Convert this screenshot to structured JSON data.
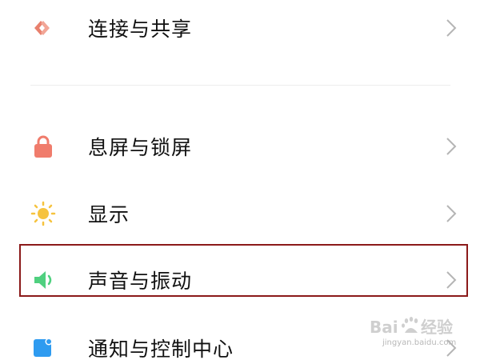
{
  "settings": {
    "items": [
      {
        "label": "连接与共享",
        "icon": "connection-share-icon",
        "color": "#e8806d"
      },
      {
        "label": "息屏与锁屏",
        "icon": "lock-icon",
        "color": "#f07c6c"
      },
      {
        "label": "显示",
        "icon": "sun-icon",
        "color": "#f6c33f"
      },
      {
        "label": "声音与振动",
        "icon": "speaker-icon",
        "color": "#4fd07f"
      },
      {
        "label": "通知与控制中心",
        "icon": "notification-icon",
        "color": "#2e9bf0"
      }
    ],
    "highlighted_item": "声音与振动",
    "highlight_color": "#8b1a1a"
  },
  "watermark": {
    "logo_text": "Baidu经验",
    "url_text": "jingyan.baidu.com"
  }
}
